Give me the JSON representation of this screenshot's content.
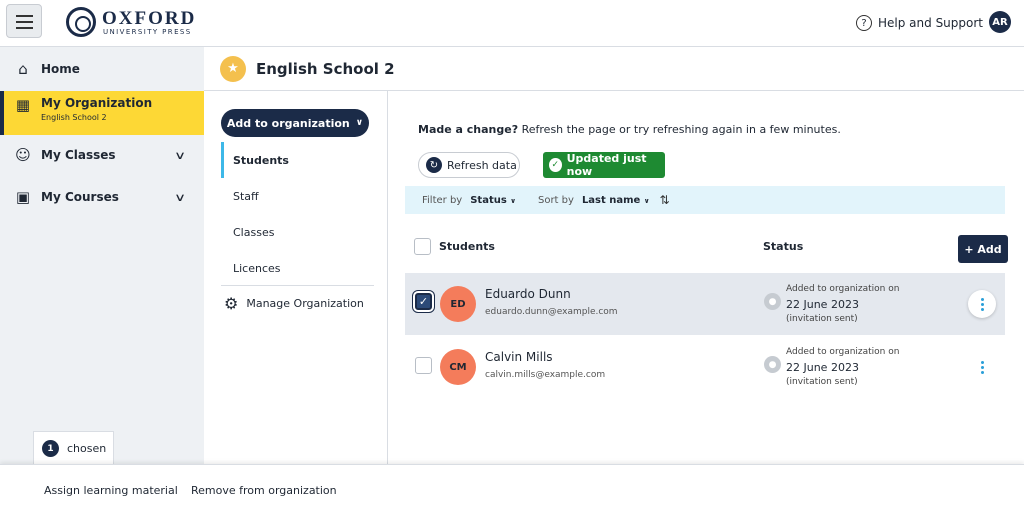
{
  "header": {
    "logo_word": "OXFORD",
    "logo_sub": "UNIVERSITY PRESS",
    "help_label": "Help and Support",
    "avatar_initials": "AR"
  },
  "sidebar": {
    "items": [
      {
        "label": "Home",
        "icon": "home-icon"
      },
      {
        "label": "My Organization",
        "sub": "English School 2",
        "icon": "organization-icon",
        "active": true
      },
      {
        "label": "My Classes",
        "icon": "classes-icon",
        "expandable": true
      },
      {
        "label": "My Courses",
        "icon": "courses-icon",
        "expandable": true
      }
    ],
    "chosen_count": "1",
    "chosen_label": "chosen"
  },
  "org": {
    "title": "English School 2"
  },
  "subnav": {
    "add_button": "Add to organization",
    "items": [
      "Students",
      "Staff",
      "Classes",
      "Licences"
    ],
    "manage_label": "Manage Organization"
  },
  "main": {
    "notice_bold": "Made a change?",
    "notice_text": " Refresh the page or try refreshing again in a few minutes.",
    "refresh_label": "Refresh data",
    "updated_label": "Updated just now",
    "filter_label": "Filter by",
    "filter_value": "Status",
    "sort_label": "Sort by",
    "sort_value": "Last name",
    "col_students": "Students",
    "col_status": "Status",
    "add_label": "+ Add",
    "rows": [
      {
        "initials": "ED",
        "name": "Eduardo Dunn",
        "email": "eduardo.dunn@example.com",
        "status_line1": "Added to organization on",
        "status_date": "22 June 2023",
        "status_line3": "(invitation sent)",
        "selected": true
      },
      {
        "initials": "CM",
        "name": "Calvin Mills",
        "email": "calvin.mills@example.com",
        "status_line1": "Added to organization on",
        "status_date": "22 June 2023",
        "status_line3": "(invitation sent)",
        "selected": false
      }
    ]
  },
  "actions": {
    "assign": "Assign learning material",
    "remove": "Remove from organization"
  },
  "colors": {
    "brand_navy": "#1b2b48",
    "active_yellow": "#fdd835",
    "success_green": "#1e8a32",
    "avatar_salmon": "#f47c5b",
    "accent_blue": "#3db8e8"
  }
}
